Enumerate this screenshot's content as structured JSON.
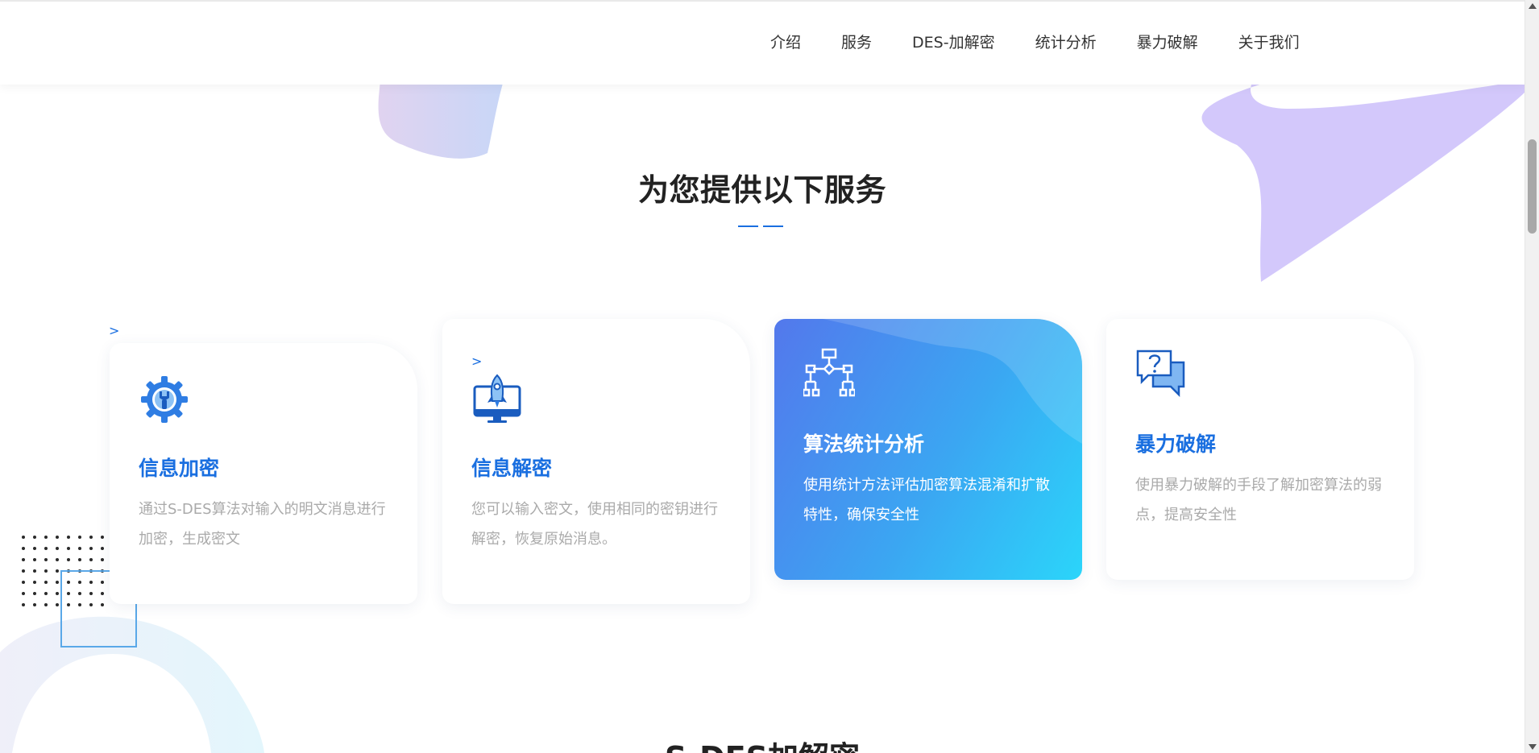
{
  "nav": {
    "items": [
      "介绍",
      "服务",
      "DES-加解密",
      "统计分析",
      "暴力破解",
      "关于我们"
    ]
  },
  "services": {
    "title": "为您提供以下服务",
    "cards": [
      {
        "title": "信息加密",
        "desc": "通过S-DES算法对输入的明文消息进行加密，生成密文",
        "icon": "gear-wrench-icon"
      },
      {
        "title": "信息解密",
        "desc": "您可以输入密文，使用相同的密钥进行解密，恢复原始消息。",
        "icon": "rocket-monitor-icon"
      },
      {
        "title": "算法统计分析",
        "desc": "使用统计方法评估加密算法混淆和扩散特性，确保安全性",
        "icon": "flowchart-icon"
      },
      {
        "title": "暴力破解",
        "desc": "使用暴力破解的手段了解加密算法的弱点，提高安全性",
        "icon": "chat-question-icon"
      }
    ],
    "arrow_marks": [
      ">",
      ">"
    ]
  },
  "next_section": {
    "title": "S-DES加解密"
  },
  "colors": {
    "accent": "#1a6fe0",
    "card_gradient_start": "#5378ec",
    "card_gradient_end": "#2bd5fa",
    "blob_purple": "#d3c8fb"
  }
}
